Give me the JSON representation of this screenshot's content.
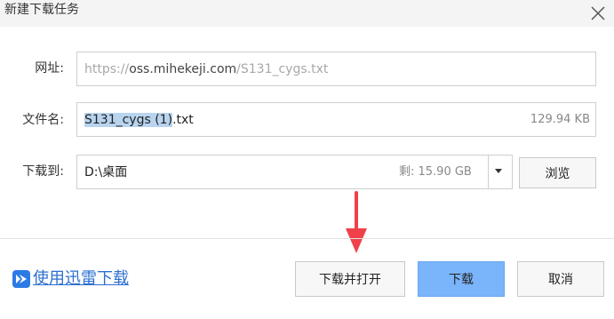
{
  "dialog": {
    "title": "新建下载任务",
    "close_icon": "close-icon"
  },
  "url_row": {
    "label": "网址:",
    "value_prefix": "https://",
    "value_domain": "oss.mihekeji.com",
    "value_path": "/S131_cygs.txt"
  },
  "filename_row": {
    "label": "文件名:",
    "selected_part": "S131_cygs (1)",
    "rest_part": ".txt",
    "file_size": "129.94 KB"
  },
  "save_row": {
    "label": "下载到:",
    "path": "D:\\桌面",
    "free_space": "剩: 15.90 GB",
    "dropdown_icon": "chevron-down-icon",
    "browse_label": "浏览"
  },
  "footer": {
    "xunlei_icon": "xunlei-bird-icon",
    "xunlei_link": "使用迅雷下载",
    "download_open_label": "下载并打开",
    "download_label": "下载",
    "cancel_label": "取消"
  },
  "colors": {
    "primary_button": "#7ab4fa",
    "selection": "#b8d4ef",
    "link": "#2c6fd1",
    "annotation_arrow": "#f0404a"
  },
  "annotation": {
    "icon": "red-down-arrow-icon"
  }
}
